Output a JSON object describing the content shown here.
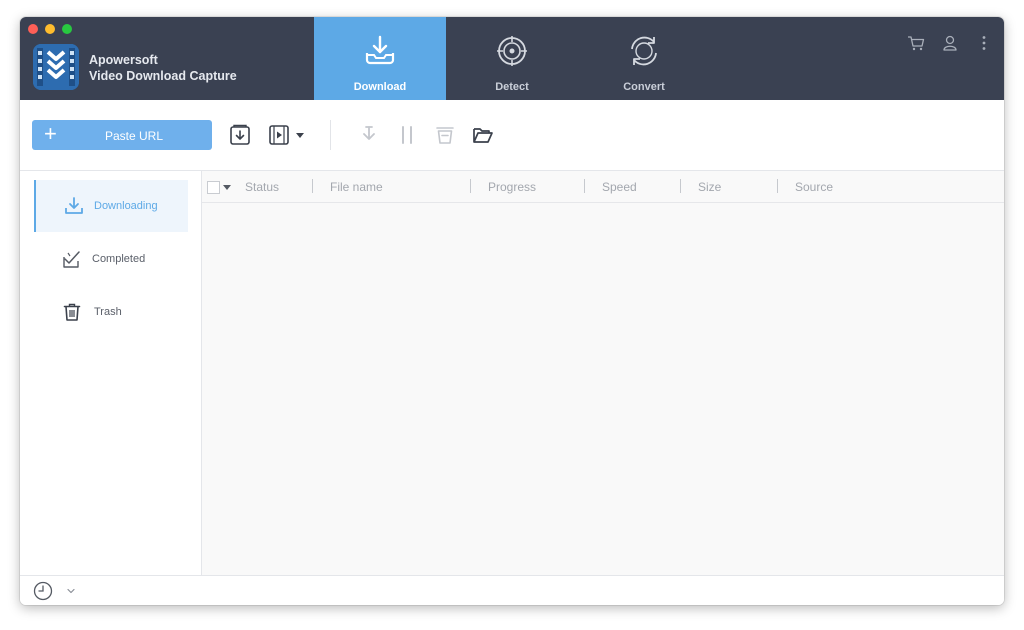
{
  "app": {
    "name_line1": "Apowersoft",
    "name_line2": "Video Download Capture"
  },
  "nav": {
    "tabs": [
      {
        "label": "Download",
        "icon": "download-tray-icon",
        "active": true
      },
      {
        "label": "Detect",
        "icon": "crosshair-target-icon",
        "active": false
      },
      {
        "label": "Convert",
        "icon": "refresh-convert-icon",
        "active": false
      }
    ]
  },
  "header_icons": [
    "cart-icon",
    "user-icon",
    "more-vertical-icon"
  ],
  "toolbar": {
    "paste_label": "Paste URL",
    "paste_icon": "plus-icon",
    "icons": [
      "download-box-icon",
      "video-download-icon",
      "chevron-down-icon",
      "resume-download-icon",
      "pause-icon",
      "delete-bin-icon",
      "open-folder-icon"
    ]
  },
  "sidebar": {
    "items": [
      {
        "label": "Downloading",
        "icon": "downloading-icon",
        "active": true
      },
      {
        "label": "Completed",
        "icon": "completed-check-icon",
        "active": false
      },
      {
        "label": "Trash",
        "icon": "trash-icon",
        "active": false
      }
    ]
  },
  "table": {
    "columns": [
      "Status",
      "File name",
      "Progress",
      "Speed",
      "Size",
      "Source"
    ],
    "rows": []
  },
  "statusbar": {
    "icons": [
      "clock-icon",
      "chevron-down-icon"
    ]
  },
  "colors": {
    "header_bg": "#3a4152",
    "accent": "#5da9e6",
    "paste_button": "#6fb0ec"
  }
}
